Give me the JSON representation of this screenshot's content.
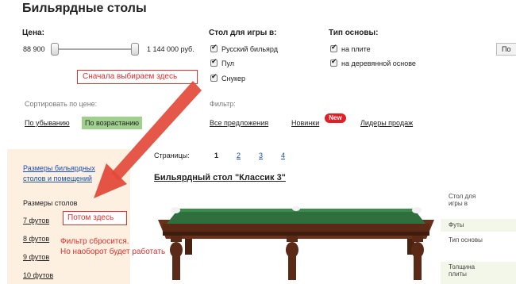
{
  "page_title": "Бильярдные столы",
  "price": {
    "label": "Цена:",
    "min": "88 900",
    "max": "1 144 000 руб.",
    "range_fraction": [
      0.0,
      1.0
    ]
  },
  "game_filter": {
    "label": "Стол для игры в:",
    "options": [
      {
        "label": "Русский бильярд",
        "checked": true
      },
      {
        "label": "Пул",
        "checked": true
      },
      {
        "label": "Снукер",
        "checked": true
      }
    ]
  },
  "base_filter": {
    "label": "Тип основы:",
    "options": [
      {
        "label": "на плите",
        "checked": true
      },
      {
        "label": "на деревянной основе",
        "checked": true
      }
    ]
  },
  "cutoff_button_label": "По",
  "annotations": {
    "first": "Сначала выбираем здесь",
    "second": "Потом здесь",
    "note_line1": "Фильтр сбросится.",
    "note_line2": "Но наоборот будет работать"
  },
  "sort": {
    "label": "Сортировать по цене:",
    "desc": "По убыванию",
    "asc": "По возрастанию",
    "active": "asc"
  },
  "filter": {
    "label": "Фильтр:",
    "all": "Все предложения",
    "new": "Новинки",
    "new_badge": "New",
    "leaders": "Лидеры продаж"
  },
  "pagination": {
    "label": "Страницы:",
    "pages": [
      "1",
      "2",
      "3",
      "4"
    ],
    "current": "1"
  },
  "sidebar": {
    "sizes_link_line1": "Размеры бильярдных",
    "sizes_link_line2": "столов и помещений",
    "heading": "Размеры столов",
    "items": [
      "7 футов",
      "8 футов",
      "9 футов",
      "10 футов"
    ]
  },
  "product": {
    "title": "Бильярдный стол \"Классик 3\""
  },
  "specs": {
    "play_line1": "Стол для",
    "play_line2": "игры в",
    "feet": "Футы",
    "base_type": "Тип основы",
    "thickness_line1": "Толщина",
    "thickness_line2": "плиты"
  },
  "colors": {
    "accent_red": "#e03030",
    "active_sort_bg": "#9fd08e",
    "sidebar_bg": "#fdf0e0",
    "table_cloth": "#2f6e3d",
    "wood": "#5a2a17"
  }
}
